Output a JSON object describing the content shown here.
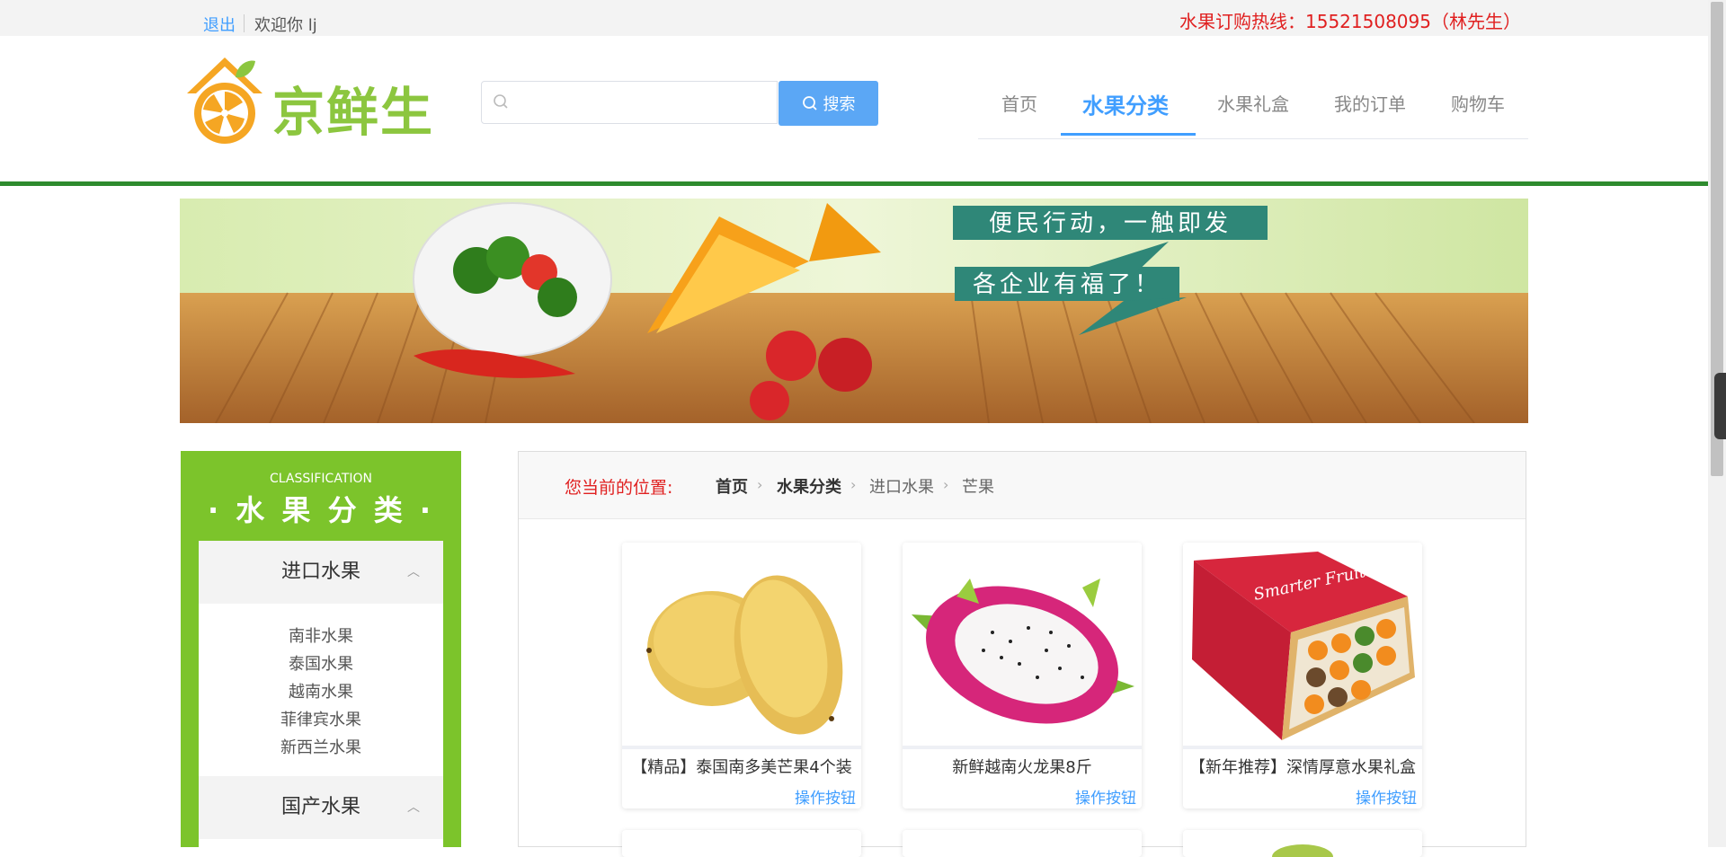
{
  "topbar": {
    "logout": "退出",
    "welcome": "欢迎你 lj",
    "hotline": "水果订购热线：15521508095（林先生）"
  },
  "header": {
    "logo_text": "京鲜生",
    "search_placeholder": "",
    "search_button": "搜索"
  },
  "nav": {
    "items": [
      {
        "label": "首页"
      },
      {
        "label": "水果分类"
      },
      {
        "label": "水果礼盒"
      },
      {
        "label": "我的订单"
      },
      {
        "label": "购物车"
      }
    ],
    "active": "水果分类"
  },
  "banner": {
    "line1": "便民行动，一触即发",
    "line2": "各企业有福了！"
  },
  "sidebar": {
    "title_en": "CLASSIFICATION",
    "title_cn": "· 水 果 分 类 ·",
    "groups": [
      {
        "label": "进口水果",
        "items": [
          "南非水果",
          "泰国水果",
          "越南水果",
          "菲律宾水果",
          "新西兰水果"
        ]
      },
      {
        "label": "国产水果",
        "items": []
      }
    ]
  },
  "breadcrumb": {
    "label": "您当前的位置:",
    "items": [
      "首页",
      "水果分类",
      "进口水果",
      "芒果"
    ]
  },
  "products": [
    {
      "name": "【精品】泰国南多美芒果4个装",
      "action": "操作按钮",
      "image": "mango"
    },
    {
      "name": "新鲜越南火龙果8斤",
      "action": "操作按钮",
      "image": "dragonfruit"
    },
    {
      "name": "【新年推荐】深情厚意水果礼盒",
      "action": "操作按钮",
      "image": "fruit-gift-box"
    }
  ],
  "giftbox_label": "Smarter Fruit",
  "colors": {
    "accent_blue": "#409eff",
    "sidebar_green": "#7cc42b",
    "hotline_red": "#e02020",
    "divider_green": "#2e8b2e"
  }
}
